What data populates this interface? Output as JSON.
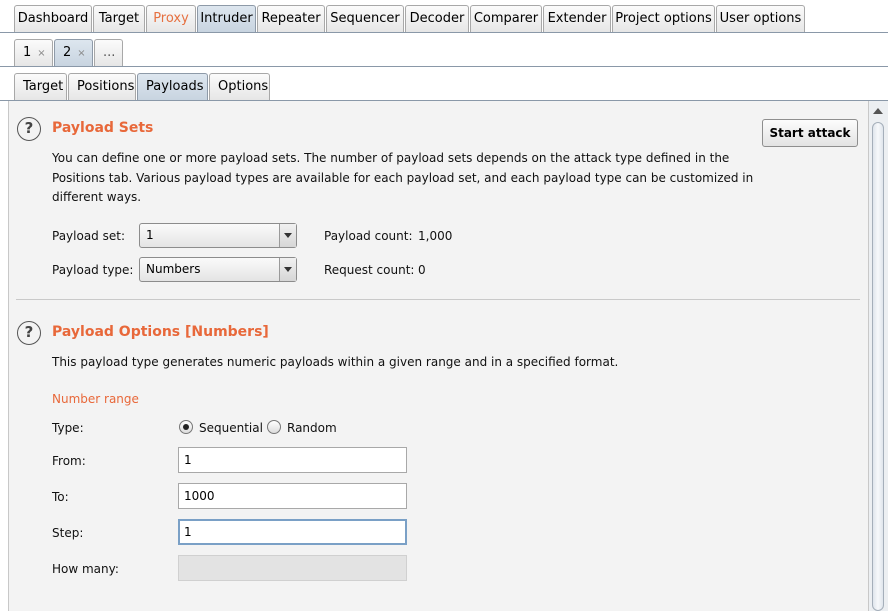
{
  "main_tabs": [
    {
      "label": "Dashboard"
    },
    {
      "label": "Target"
    },
    {
      "label": "Proxy"
    },
    {
      "label": "Intruder"
    },
    {
      "label": "Repeater"
    },
    {
      "label": "Sequencer"
    },
    {
      "label": "Decoder"
    },
    {
      "label": "Comparer"
    },
    {
      "label": "Extender"
    },
    {
      "label": "Project options"
    },
    {
      "label": "User options"
    }
  ],
  "active_main_tab": "Intruder",
  "attack_tabs": [
    {
      "label": "1",
      "close": "×"
    },
    {
      "label": "2",
      "close": "×"
    },
    {
      "label": "..."
    }
  ],
  "active_attack_tab": "2",
  "sub_tabs": [
    {
      "label": "Target"
    },
    {
      "label": "Positions"
    },
    {
      "label": "Payloads"
    },
    {
      "label": "Options"
    }
  ],
  "active_sub_tab": "Payloads",
  "payload_sets": {
    "title": "Payload Sets",
    "description_lines": [
      "You can define one or more payload sets. The number of payload sets depends on the attack type defined in the",
      "Positions tab. Various payload types are available for each payload set, and each payload type can be customized in",
      "different ways."
    ],
    "start_attack_label": "Start attack",
    "payload_set_label": "Payload set:",
    "payload_set_value": "1",
    "payload_type_label": "Payload type:",
    "payload_type_value": "Numbers",
    "payload_count_label": "Payload count:",
    "payload_count_value": "1,000",
    "request_count_label": "Request count:",
    "request_count_value": "0"
  },
  "payload_options": {
    "title": "Payload Options [Numbers]",
    "description": "This payload type generates numeric payloads within a given range and in a specified format.",
    "number_range_label": "Number range",
    "type_label": "Type:",
    "type_options": [
      "Sequential",
      "Random"
    ],
    "type_selected": "Sequential",
    "from_label": "From:",
    "from_value": "1",
    "to_label": "To:",
    "to_value": "1000",
    "step_label": "Step:",
    "step_value": "1",
    "how_many_label": "How many:",
    "how_many_value": ""
  },
  "colors": {
    "accent_orange": "#e8683a",
    "active_tab": "#c8d4e0",
    "panel_bg": "#f3f3f3"
  }
}
